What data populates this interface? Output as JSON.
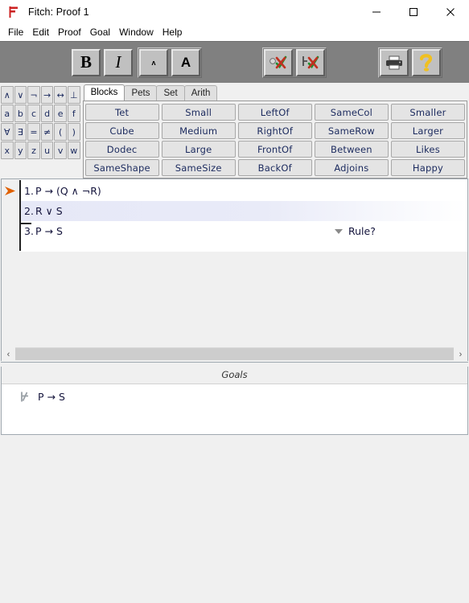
{
  "window": {
    "title": "Fitch: Proof 1",
    "app_icon": "fitch-flag-icon",
    "controls": {
      "minimize": "—",
      "maximize": "☐",
      "close": "✕"
    }
  },
  "menubar": {
    "items": [
      {
        "label": "File"
      },
      {
        "label": "Edit"
      },
      {
        "label": "Proof"
      },
      {
        "label": "Goal"
      },
      {
        "label": "Window"
      },
      {
        "label": "Help"
      }
    ]
  },
  "toolbar": {
    "bold_label": "B",
    "italic_label": "I",
    "font_smaller_label": "ʌ",
    "font_larger_label": "A",
    "verify_step_icon": "verify-step-icon",
    "verify_proof_icon": "verify-proof-icon",
    "print_icon": "printer-icon",
    "help_icon": "help-question-icon"
  },
  "symbol_palette": {
    "rows": [
      [
        "∧",
        "∨",
        "¬",
        "→",
        "↔",
        "⊥"
      ],
      [
        "a",
        "b",
        "c",
        "d",
        "e",
        "f"
      ],
      [
        "∀",
        "∃",
        "=",
        "≠",
        "(",
        ")"
      ],
      [
        "x",
        "y",
        "z",
        "u",
        "v",
        "w"
      ]
    ]
  },
  "predicate_tabs": {
    "tabs": [
      {
        "label": "Blocks",
        "active": true
      },
      {
        "label": "Pets",
        "active": false
      },
      {
        "label": "Set",
        "active": false
      },
      {
        "label": "Arith",
        "active": false
      }
    ],
    "buttons": [
      "Tet",
      "Small",
      "LeftOf",
      "SameCol",
      "Smaller",
      "Cube",
      "Medium",
      "RightOf",
      "SameRow",
      "Larger",
      "Dodec",
      "Large",
      "FrontOf",
      "Between",
      "Likes",
      "SameShape",
      "SameSize",
      "BackOf",
      "Adjoins",
      "Happy"
    ]
  },
  "proof": {
    "focus_arrow_icon": "focus-arrow-icon",
    "lines": [
      {
        "number": "1.",
        "formula": "P → (Q ∧ ¬R)",
        "rule": "",
        "highlighted": false
      },
      {
        "number": "2.",
        "formula": "R ∨ S",
        "rule": "",
        "highlighted": true
      },
      {
        "number": "3.",
        "formula": "P → S",
        "rule": "Rule?",
        "highlighted": false
      }
    ]
  },
  "scrollbar": {
    "left_arrow": "‹",
    "right_arrow": "›"
  },
  "goals": {
    "header": "Goals",
    "items": [
      {
        "icon": "not-proved-turnstile-icon",
        "formula": "P → S"
      }
    ]
  },
  "colors": {
    "toolbar_bg": "#808080",
    "panel_bg": "#f0f0f0",
    "highlight": "#e8eaf8",
    "formula_text": "#14143c",
    "predicate_text": "#1b2a5e",
    "logo_red": "#cc2222",
    "focus_arrow": "#e06000",
    "help_yellow": "#f0c020"
  }
}
